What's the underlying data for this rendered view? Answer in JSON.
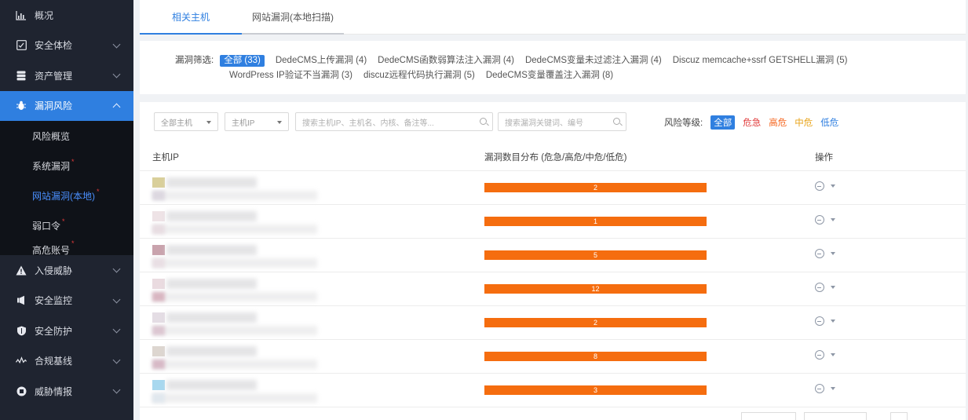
{
  "sidebar": {
    "items": [
      {
        "label": "概况",
        "icon": "bar-chart-icon"
      },
      {
        "label": "安全体检",
        "icon": "check-box-icon"
      },
      {
        "label": "资产管理",
        "icon": "database-icon"
      },
      {
        "label": "漏洞风险",
        "icon": "bug-icon"
      },
      {
        "label": "入侵威胁",
        "icon": "warning-icon"
      },
      {
        "label": "安全监控",
        "icon": "monitor-icon"
      },
      {
        "label": "安全防护",
        "icon": "shield-icon"
      },
      {
        "label": "合规基线",
        "icon": "pulse-icon"
      },
      {
        "label": "威胁情报",
        "icon": "intel-icon"
      }
    ],
    "submenu": [
      {
        "label": "风险概览",
        "dot": false
      },
      {
        "label": "系统漏洞",
        "dot": true
      },
      {
        "label": "网站漏洞(本地)",
        "dot": true
      },
      {
        "label": "弱口令",
        "dot": true
      },
      {
        "label": "高危账号",
        "dot": true
      }
    ],
    "dot_mark": "*"
  },
  "tabs": [
    {
      "label": "相关主机"
    },
    {
      "label": "网站漏洞(本地扫描)"
    }
  ],
  "filter": {
    "title": "漏洞筛选:",
    "chips": [
      "全部 (33)",
      "DedeCMS上传漏洞 (4)",
      "DedeCMS函数弱算法注入漏洞 (4)",
      "DedeCMS变量未过滤注入漏洞 (4)",
      "Discuz memcache+ssrf GETSHELL漏洞 (5)",
      "WordPress IP验证不当漏洞 (3)",
      "discuz远程代码执行漏洞 (5)",
      "DedeCMS变量覆盖注入漏洞 (8)"
    ]
  },
  "toolbar": {
    "host_select": "全部主机",
    "ip_select": "主机IP",
    "host_search_placeholder": "搜索主机IP、主机名、内核、备注等...",
    "vuln_search_placeholder": "搜索漏洞关键词、编号"
  },
  "risk": {
    "title": "风险等级:",
    "levels": [
      "全部",
      "危急",
      "高危",
      "中危",
      "低危"
    ],
    "colors": [
      "#ffffff",
      "#e03a3a",
      "#f5641c",
      "#e8a317",
      "#2f7fe0"
    ]
  },
  "table": {
    "headers": [
      "主机IP",
      "漏洞数目分布 (危急/高危/中危/低危)",
      "操作"
    ],
    "rows": [
      {
        "count": "2",
        "swatch": "#d9cf9a",
        "swatch2": "#dcd7e0"
      },
      {
        "count": "1",
        "swatch": "#eee3e6",
        "swatch2": "#e8dde2"
      },
      {
        "count": "5",
        "swatch": "#c9a3ad",
        "swatch2": "#e9dfe4"
      },
      {
        "count": "12",
        "swatch": "#eadbe0",
        "swatch2": "#d9b6c1"
      },
      {
        "count": "2",
        "swatch": "#e4dde4",
        "swatch2": "#dcc6d1"
      },
      {
        "count": "8",
        "swatch": "#ddd6d0",
        "swatch2": "#d7b9c6"
      },
      {
        "count": "3",
        "swatch": "#a8d8ef",
        "swatch2": "#e1e8ee"
      }
    ]
  }
}
